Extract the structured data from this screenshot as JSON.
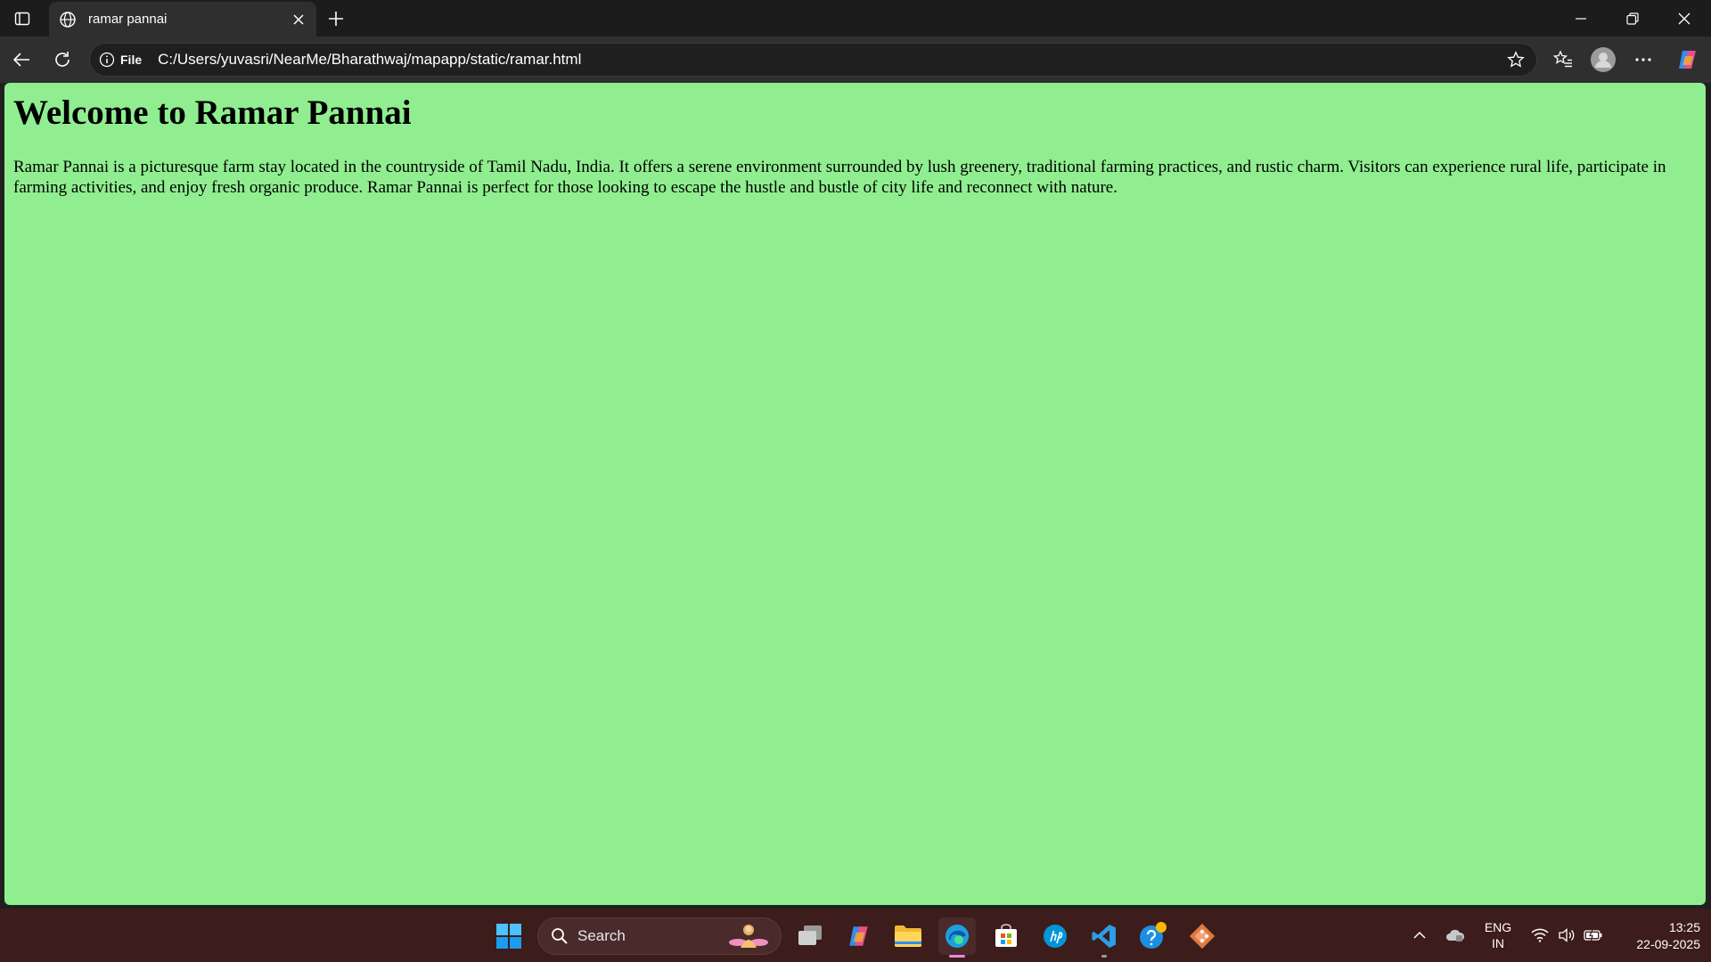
{
  "browser": {
    "tab_title": "ramar pannai",
    "site_info_label": "File",
    "url": "C:/Users/yuvasri/NearMe/Bharathwaj/mapapp/static/ramar.html"
  },
  "page": {
    "heading": "Welcome to Ramar Pannai",
    "body": "Ramar Pannai is a picturesque farm stay located in the countryside of Tamil Nadu, India. It offers a serene environment surrounded by lush greenery, traditional farming practices, and rustic charm. Visitors can experience rural life, participate in farming activities, and enjoy fresh organic produce. Ramar Pannai is perfect for those looking to escape the hustle and bustle of city life and reconnect with nature.",
    "background_color": "#90ee90"
  },
  "taskbar": {
    "search_label": "Search",
    "lang_top": "ENG",
    "lang_bottom": "IN",
    "time": "13:25",
    "date": "22-09-2025",
    "apps": [
      "start-icon",
      "task-view-icon",
      "copilot-icon",
      "file-explorer-icon",
      "edge-icon",
      "store-icon",
      "hp-icon",
      "vscode-icon",
      "help-icon",
      "git-icon"
    ]
  }
}
